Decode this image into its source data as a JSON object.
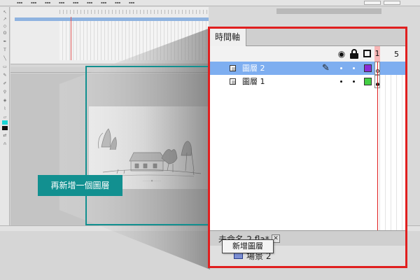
{
  "colors": {
    "highlight_border": "#e01f1f",
    "callout_teal": "#129090",
    "selected_row": "#7eaef0",
    "layer2_color": "#8b2bd6",
    "layer1_color": "#44cf44"
  },
  "timeline": {
    "tab_label": "時間軸",
    "frame_numbers": [
      "1",
      "5"
    ],
    "header_icons": [
      "eye-icon",
      "lock-icon",
      "outline-icon"
    ],
    "layers": [
      {
        "name": "圖層 2",
        "selected": true,
        "color": "#8b2bd6"
      },
      {
        "name": "圖層 1",
        "selected": false,
        "color": "#44cf44"
      }
    ],
    "footer": {
      "tooltip": "新增圖層"
    }
  },
  "document": {
    "tab_label": "未命名-2.fla*",
    "close_label": "✕",
    "scene_label": "場景 2"
  },
  "callout": {
    "text": "再新增一個圖層"
  }
}
